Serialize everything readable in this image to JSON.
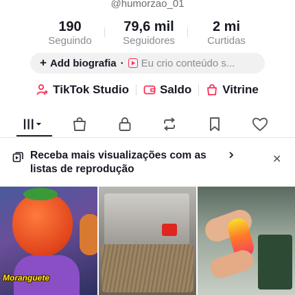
{
  "profile": {
    "username": "@humorzao_01"
  },
  "stats": [
    {
      "value": "190",
      "label": "Seguindo"
    },
    {
      "value": "79,6 mil",
      "label": "Seguidores"
    },
    {
      "value": "2 mi",
      "label": "Curtidas"
    }
  ],
  "bio": {
    "add_label": "Add biografia",
    "separator": "·",
    "description": "Eu crio conteúdo s..."
  },
  "links": [
    {
      "label": "TikTok Studio",
      "icon": "studio-icon"
    },
    {
      "label": "Saldo",
      "icon": "wallet-icon"
    },
    {
      "label": "Vitrine",
      "icon": "shopping-bag-icon"
    }
  ],
  "tabs": [
    {
      "name": "videos-grid",
      "icon": "grid-dropdown-icon",
      "active": true
    },
    {
      "name": "shop",
      "icon": "bag-icon"
    },
    {
      "name": "private",
      "icon": "lock-icon"
    },
    {
      "name": "reposts",
      "icon": "repost-icon"
    },
    {
      "name": "favorites",
      "icon": "bookmark-icon"
    },
    {
      "name": "liked",
      "icon": "heart-icon"
    }
  ],
  "banner": {
    "text": "Receba mais visualizações com as listas de reprodução",
    "icon": "playlist-icon",
    "close": "✕"
  },
  "videos": [
    {
      "overlay_text": "Moranguete"
    },
    {
      "overlay_text": ""
    },
    {
      "overlay_text": ""
    }
  ],
  "colors": {
    "accent": "#fe2c55",
    "text": "#161823",
    "muted": "#8a8b91"
  }
}
